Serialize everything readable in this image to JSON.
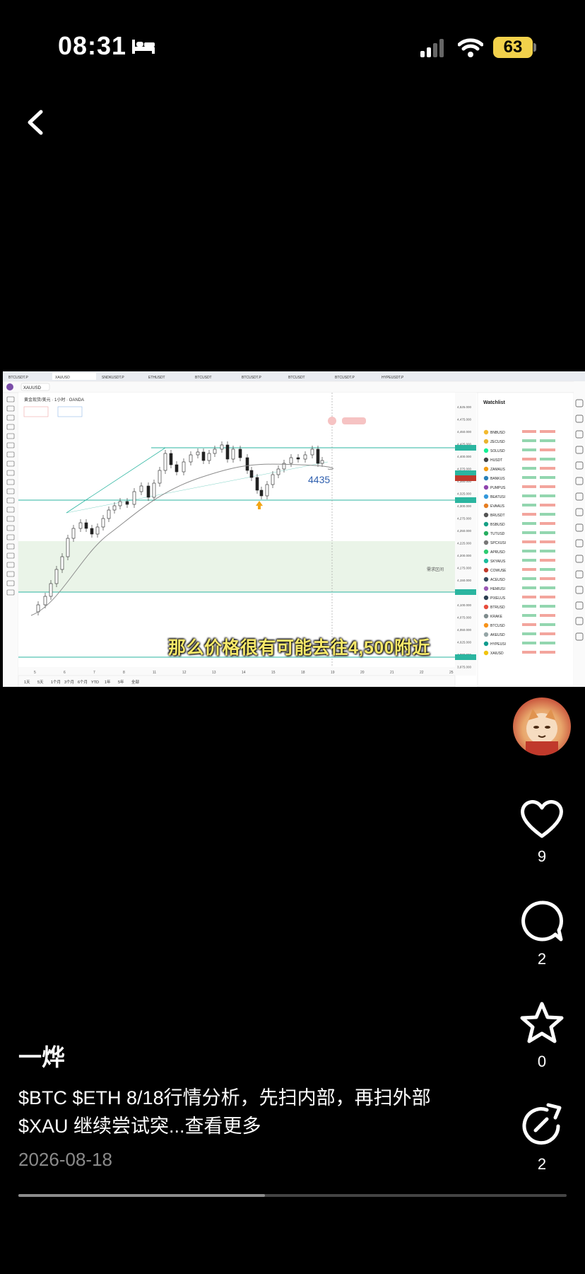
{
  "status_bar": {
    "time": "08:31",
    "battery": "63"
  },
  "video": {
    "subtitle": "那么价格很有可能去往4,500附近",
    "progress": 0.45,
    "chart": {
      "symbol": "XAUUSD",
      "title": "黄金现货/美元 · 1小时 · OANDA",
      "target_label": "4435",
      "zone_label": "需求区间",
      "watchlist_title": "Watchlist",
      "watchlist": [
        "BNBUSD",
        "ZECUSD",
        "SOLUSD",
        "HUSDT",
        "ZAMAUS",
        "BANKUS",
        "PUMPUS",
        "BEATUSI",
        "EVAAUS",
        "BRUSDT",
        "BSBUSD",
        "TUTUSD",
        "SPCXUSI",
        "APRUSD",
        "SKYAIUS",
        "COWUSE",
        "ACEUSD",
        "HEMIUSI",
        "PIXELUS",
        "BTRUSD",
        "KRAKE",
        "BTCUSD",
        "AKEUSD",
        "HYPEUSI",
        "XAIUSD"
      ],
      "price_ticks": [
        "4,525.000",
        "4,475.000",
        "4,450.000",
        "4,425.000",
        "4,400.000",
        "4,375.000",
        "4,350.000",
        "4,325.000",
        "4,300.000",
        "4,275.000",
        "4,250.000",
        "4,225.000",
        "4,200.000",
        "4,175.000",
        "4,150.000",
        "4,125.000",
        "4,100.000",
        "4,075.000",
        "4,050.000",
        "4,025.000",
        "4,000.000",
        "3,975.000"
      ],
      "date_ticks": [
        "5",
        "6",
        "7",
        "8",
        "11",
        "12",
        "13",
        "14",
        "15",
        "18",
        "19",
        "20",
        "21",
        "22",
        "25"
      ],
      "timeframes": [
        "1天",
        "5天",
        "1个月",
        "3个月",
        "6个月",
        "YTD",
        "1年",
        "5年",
        "全部"
      ],
      "tabs": [
        "BTCUSDT.P",
        "XAUUSD",
        "SNDKUSDT.P",
        "ETHUSDT",
        "BTCUSDT",
        "BTCUSDT.P",
        "BTCUSDT",
        "BTCUSDT.P",
        "HYPEUSDT.P"
      ]
    }
  },
  "actions": {
    "likes": "9",
    "comments": "2",
    "favorites": "0",
    "shares": "2"
  },
  "post": {
    "author": "一烨",
    "caption_line1": "$BTC $ETH 8/18行情分析，先扫内部，再扫外部",
    "caption_line2": "$XAU 继续尝试突...查看更多",
    "date": "2026-08-18"
  },
  "colors": {
    "battery": "#f2d14b",
    "subtitle": "#f6e86a",
    "accent_line": "#2bb5a0"
  }
}
